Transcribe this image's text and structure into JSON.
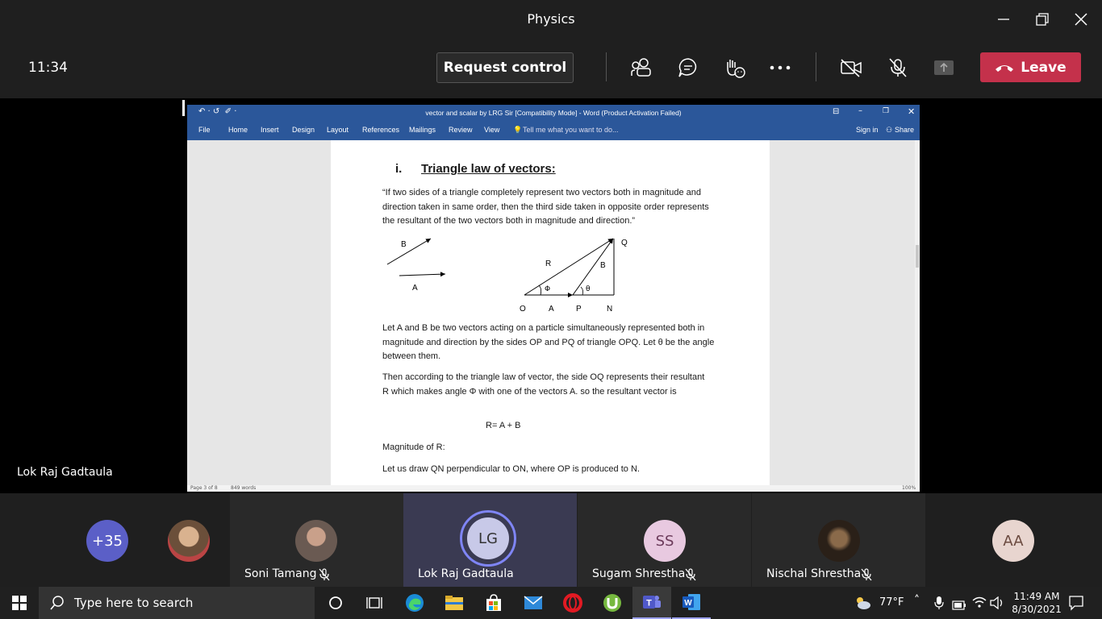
{
  "window": {
    "title": "Physics"
  },
  "meeting": {
    "clock": "11:34",
    "request_control": "Request control",
    "leave_label": "Leave",
    "sharer_name": "Lok Raj Gadtaula"
  },
  "word": {
    "title": "vector and scalar by LRG Sir [Compatibility Mode] - Word (Product Activation Failed)",
    "tabs": [
      "File",
      "Home",
      "Insert",
      "Design",
      "Layout",
      "References",
      "Mailings",
      "Review",
      "View"
    ],
    "tell_me": "Tell me what you want to do...",
    "sign_in": "Sign in",
    "share": "Share",
    "status_page": "Page 3 of 8",
    "status_words": "849 words",
    "status_zoom": "100%"
  },
  "doc": {
    "heading_num": "i.",
    "heading": "Triangle law of vectors:",
    "quote": "“If two sides of a triangle completely represent two vectors both in magnitude and direction taken in same order, then the third side taken in opposite order represents the resultant of the two vectors both in magnitude and direction.”",
    "fig": {
      "B": "B",
      "A": "A",
      "R": "R",
      "B2": "B",
      "Q": "Q",
      "phi": "Φ",
      "theta": "θ",
      "O": "O",
      "A2": "A",
      "P": "P",
      "N": "N"
    },
    "para1": "Let A and B be two vectors acting on a particle simultaneously represented both in magnitude and direction by the sides OP and PQ of  triangle OPQ. Let θ be the angle between them.",
    "para2": "Then according to the triangle law of vector, the side OQ represents their resultant R which makes angle Φ with one of the vectors A. so the resultant vector is",
    "equation": "R=  A  + B",
    "magnitude": "Magnitude of R:",
    "para3": "Let us draw QN perpendicular to ON, where OP is produced to N."
  },
  "participants": [
    {
      "label": "+35",
      "color": "#5b5fc7"
    },
    {
      "label": "",
      "color": "#8a6a4a"
    },
    {
      "label": "",
      "name": "Soni Tamang",
      "color": "#7a6a60"
    },
    {
      "label": "LG",
      "name": "Lok Raj Gadtaula",
      "color": "#c8c9e8"
    },
    {
      "label": "SS",
      "name": "Sugam Shrestha",
      "color": "#e8c9e0"
    },
    {
      "label": "",
      "name": "Nischal Shrestha",
      "color": "#4a3a2a"
    },
    {
      "label": "AA",
      "color": "#e8d5cf"
    }
  ],
  "taskbar": {
    "search_placeholder": "Type here to search",
    "weather": "77°F",
    "time": "11:49 AM",
    "date": "8/30/2021"
  }
}
